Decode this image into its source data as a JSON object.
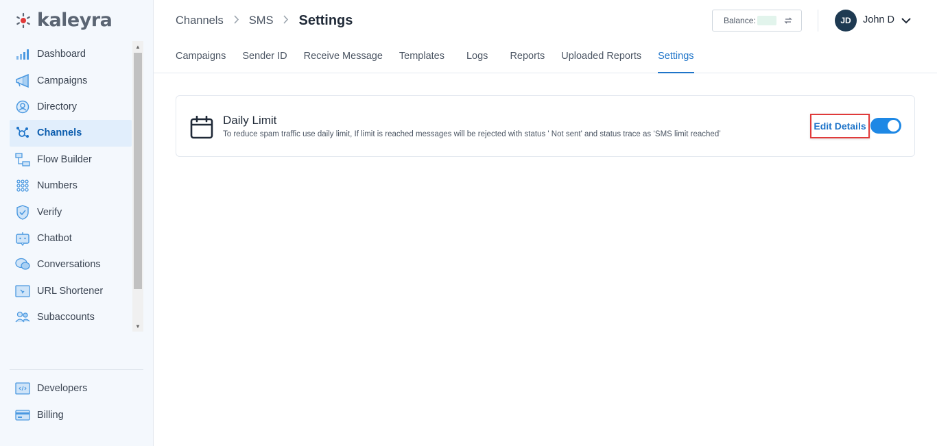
{
  "brand": {
    "name": "kaleyra",
    "accent": "#1e74c9",
    "logo_accent": "#e03a3a"
  },
  "sidebar": {
    "items": [
      {
        "label": "Dashboard",
        "icon": "dashboard-icon"
      },
      {
        "label": "Campaigns",
        "icon": "megaphone-icon"
      },
      {
        "label": "Directory",
        "icon": "contact-icon"
      },
      {
        "label": "Channels",
        "icon": "channels-icon",
        "active": true
      },
      {
        "label": "Flow Builder",
        "icon": "flow-icon"
      },
      {
        "label": "Numbers",
        "icon": "dialpad-icon"
      },
      {
        "label": "Verify",
        "icon": "shield-icon"
      },
      {
        "label": "Chatbot",
        "icon": "chatbot-icon"
      },
      {
        "label": "Conversations",
        "icon": "chat-icon"
      },
      {
        "label": "URL Shortener",
        "icon": "link-icon"
      },
      {
        "label": "Subaccounts",
        "icon": "users-icon"
      }
    ],
    "bottom_items": [
      {
        "label": "Developers",
        "icon": "code-icon"
      },
      {
        "label": "Billing",
        "icon": "card-icon"
      }
    ]
  },
  "header": {
    "breadcrumb": [
      "Channels",
      "SMS",
      "Settings"
    ],
    "balance_label": "Balance:",
    "user": {
      "initials": "JD",
      "name": "John D"
    }
  },
  "tabs": [
    "Campaigns",
    "Sender ID",
    "Receive Message",
    "Templates",
    "Logs",
    "Reports",
    "Uploaded Reports",
    "Settings"
  ],
  "active_tab": "Settings",
  "daily_limit": {
    "title": "Daily Limit",
    "description": "To reduce spam traffic use daily limit, If limit is reached messages will be rejected with status ' Not sent' and status trace as ‘SMS limit reached’",
    "edit_label": "Edit Details",
    "enabled": true
  }
}
